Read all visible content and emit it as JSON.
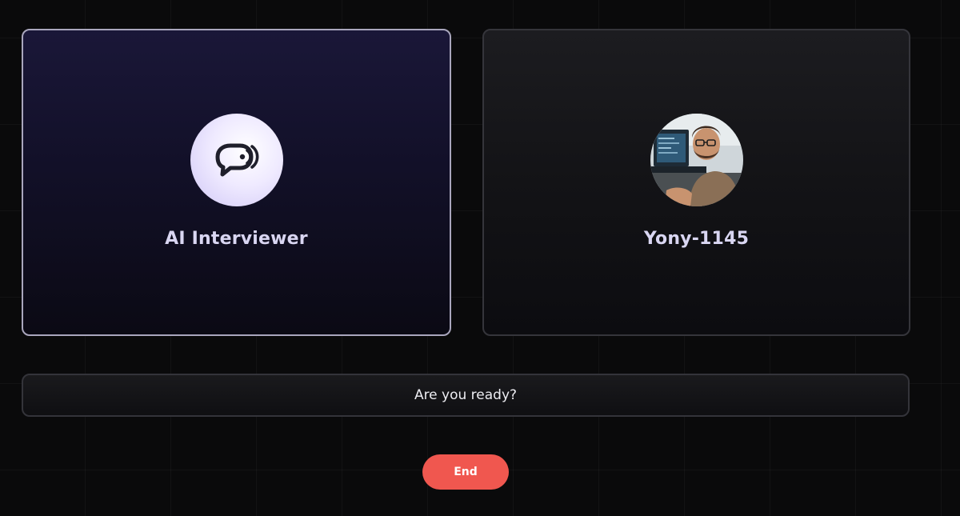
{
  "ai_card": {
    "name": "AI Interviewer",
    "icon": "chat-bubble-sound-icon"
  },
  "user_card": {
    "name": "Yony-1145",
    "icon": "user-avatar"
  },
  "transcript": {
    "text": "Are you ready?"
  },
  "controls": {
    "end_label": "End"
  },
  "colors": {
    "end_button": "#f0574f",
    "ai_card_border": "#a9a6bd",
    "title_text": "#d9d6f2"
  }
}
